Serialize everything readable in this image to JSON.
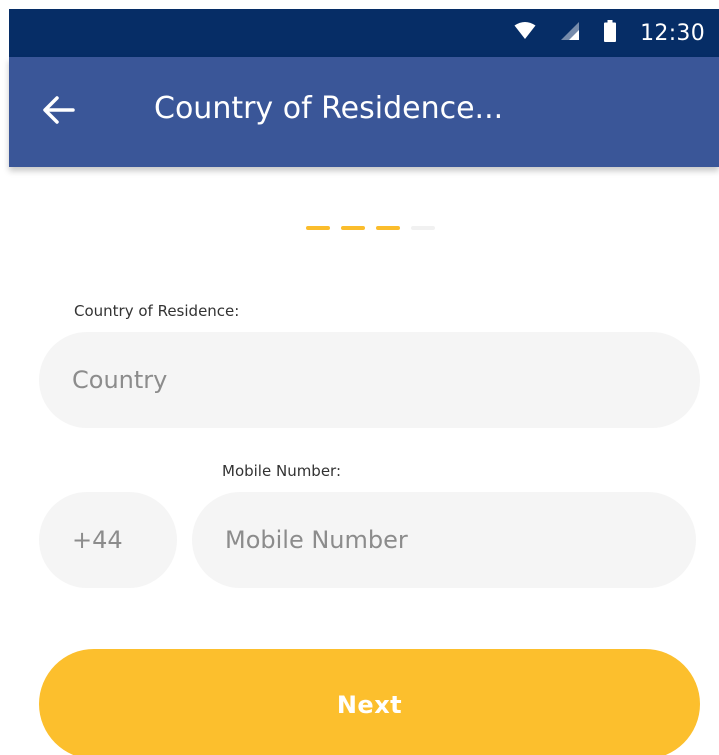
{
  "status_bar": {
    "time": "12:30",
    "icons": [
      "wifi-icon",
      "cellular-signal-icon",
      "battery-icon"
    ]
  },
  "app_bar": {
    "back_icon": "arrow-left-icon",
    "title": "Country of Residence..."
  },
  "stepper": {
    "total_steps": 4,
    "completed_steps": 3,
    "active_color": "#fbbd2c",
    "inactive_color": "#f1f1f1"
  },
  "form": {
    "country_label": "Country of Residence:",
    "country_placeholder": "Country",
    "country_value": "",
    "mobile_label": "Mobile Number:",
    "dial_code": "+44",
    "mobile_placeholder": "Mobile Number",
    "mobile_value": ""
  },
  "actions": {
    "next_label": "Next"
  },
  "colors": {
    "status_bar": "#062d66",
    "app_bar": "#3a5698",
    "accent": "#fcbf2d",
    "input_bg": "#f5f5f5"
  }
}
